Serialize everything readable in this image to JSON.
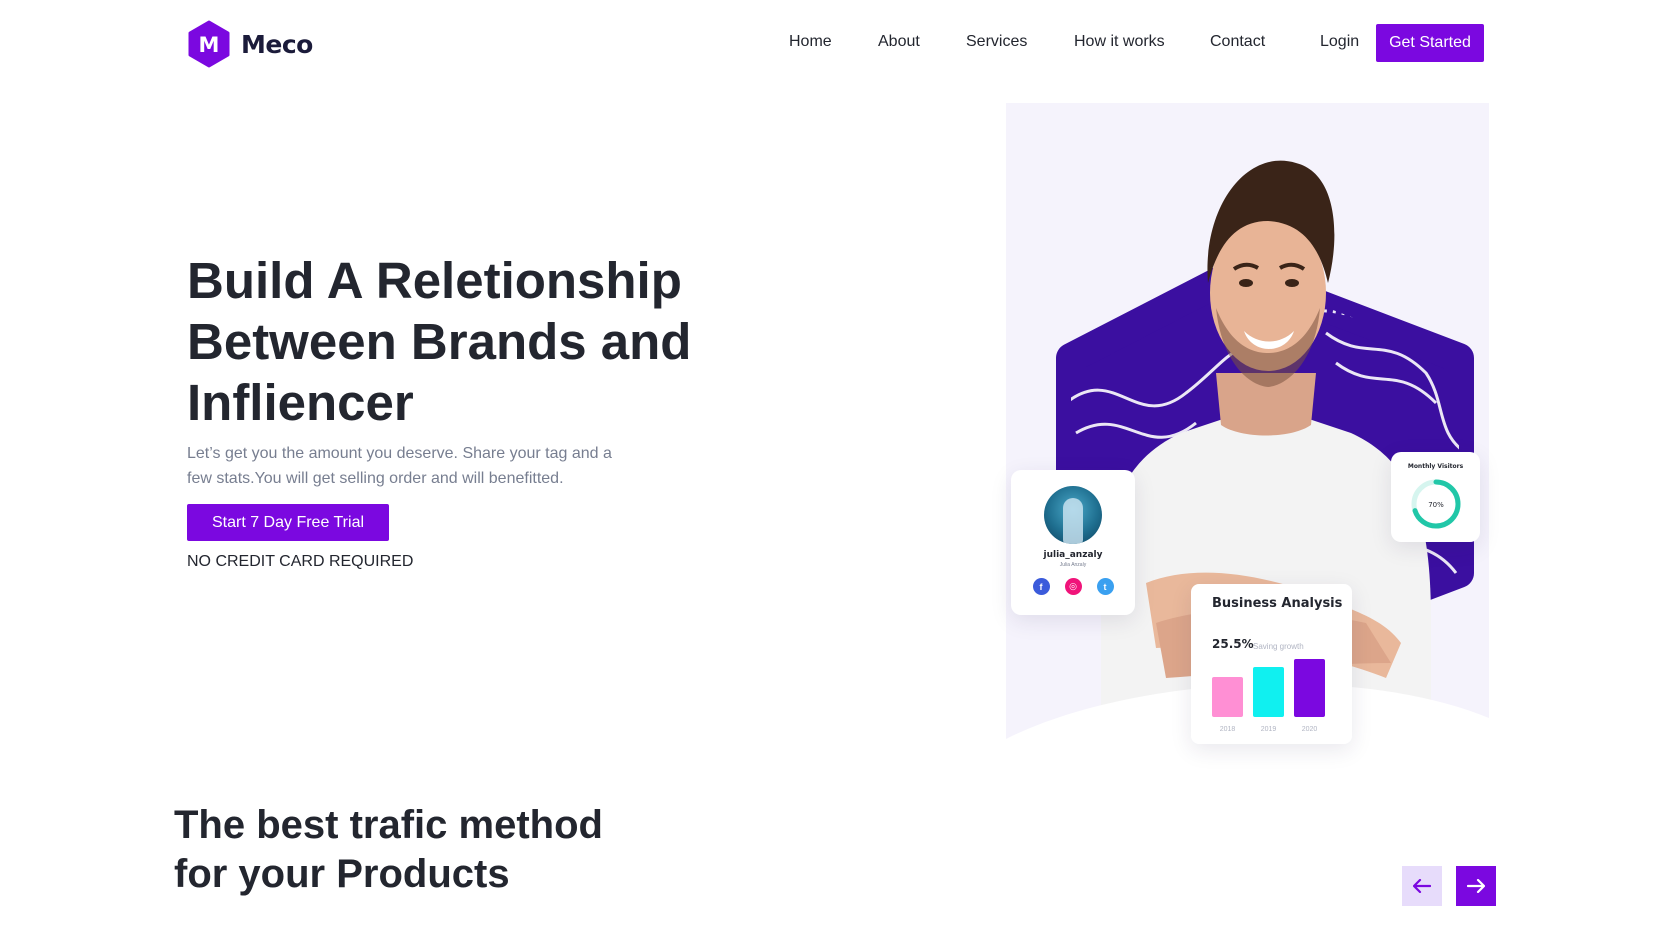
{
  "brand": {
    "logo_letter": "M",
    "name": "Meco",
    "accent_color": "#7b08e0",
    "dark_purple": "#3b0fa0"
  },
  "nav": {
    "items": [
      {
        "label": "Home"
      },
      {
        "label": "About"
      },
      {
        "label": "Services"
      },
      {
        "label": "How it works"
      },
      {
        "label": "Contact"
      }
    ],
    "login_label": "Login",
    "cta_label": "Get Started"
  },
  "hero": {
    "title_line1": "Build A Reletionship",
    "title_line2": "Between Brands and",
    "title_line3": "Infliencer",
    "subtitle": "Let’s get you the amount you deserve. Share your tag and a few stats.You will get selling order and will benefitted.",
    "cta_label": "Start 7 Day Free Trial",
    "note": "NO CREDIT CARD REQUIRED"
  },
  "profile_card": {
    "handle": "julia_anzaly",
    "name": "Julia Anzaly",
    "socials": [
      {
        "icon": "facebook-icon",
        "glyph": "f",
        "color": "#3b5bdb"
      },
      {
        "icon": "instagram-icon",
        "glyph": "◎",
        "color": "#f0147a"
      },
      {
        "icon": "twitter-icon",
        "glyph": "t",
        "color": "#3aa0f0"
      }
    ]
  },
  "visitors_card": {
    "title": "Monthly Visitors",
    "value_label": "70%",
    "value": 0.7,
    "ring_color": "#21c7a8"
  },
  "analysis_card": {
    "title": "Business Analysis",
    "percent": "25.5%",
    "percent_note": "Saving growth",
    "bars": [
      {
        "year": "2018",
        "value": 40,
        "color": "#ff8fd4"
      },
      {
        "year": "2019",
        "value": 50,
        "color": "#10f0f0"
      },
      {
        "year": "2020",
        "value": 58,
        "color": "#7b08e0"
      }
    ]
  },
  "section2": {
    "title_line1": "The best trafic method",
    "title_line2": "for your Products",
    "prev_icon": "arrow-left-icon",
    "next_icon": "arrow-right-icon"
  }
}
